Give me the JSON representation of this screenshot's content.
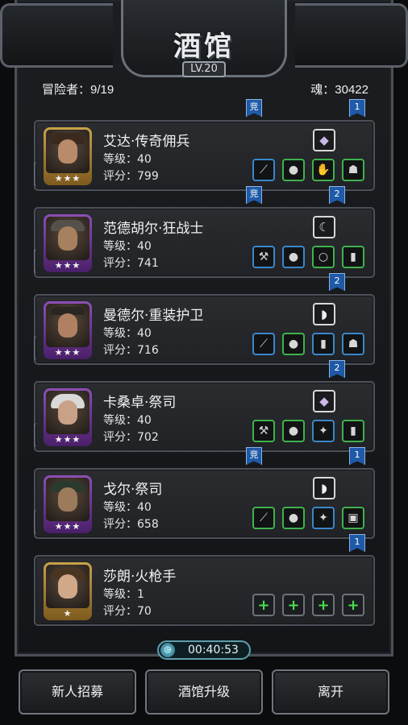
{
  "header": {
    "title": "酒馆",
    "level": "LV.20",
    "adventurers": "冒险者：9/19",
    "souls": "魂：30422"
  },
  "heroes": [
    {
      "name": "艾达·传奇佣兵",
      "level": "等级：40",
      "score": "评分：799",
      "stars": "★★★",
      "frame": "gold",
      "weapon_icon": "crystal-icon",
      "gear": [
        {
          "icon": "staff-icon",
          "color": "blue"
        },
        {
          "icon": "armor-icon",
          "color": "green"
        },
        {
          "icon": "gauntlet-icon",
          "color": "green"
        },
        {
          "icon": "pet-icon",
          "color": "green"
        }
      ]
    },
    {
      "name": "范德胡尔·狂战士",
      "level": "等级：40",
      "score": "评分：741",
      "stars": "★★★",
      "frame": "purple",
      "weapon_icon": "claw-icon",
      "gear": [
        {
          "icon": "axe-icon",
          "color": "blue"
        },
        {
          "icon": "armor-icon",
          "color": "blue"
        },
        {
          "icon": "ring-icon",
          "color": "green"
        },
        {
          "icon": "scroll-icon",
          "color": "green"
        }
      ]
    },
    {
      "name": "曼德尔·重装护卫",
      "level": "等级：40",
      "score": "评分：716",
      "stars": "★★★",
      "frame": "purple",
      "weapon_icon": "horn-icon",
      "gear": [
        {
          "icon": "sword-icon",
          "color": "blue"
        },
        {
          "icon": "armor-icon",
          "color": "green"
        },
        {
          "icon": "scroll-icon",
          "color": "blue"
        },
        {
          "icon": "pet-icon",
          "color": "blue"
        }
      ]
    },
    {
      "name": "卡桑卓·祭司",
      "level": "等级：40",
      "score": "评分：702",
      "stars": "★★★",
      "frame": "purple",
      "weapon_icon": "crystal-icon",
      "gear": [
        {
          "icon": "hammer-icon",
          "color": "green"
        },
        {
          "icon": "armor-icon",
          "color": "green"
        },
        {
          "icon": "amulet-icon",
          "color": "blue"
        },
        {
          "icon": "scroll-icon",
          "color": "green"
        }
      ]
    },
    {
      "name": "戈尔·祭司",
      "level": "等级：40",
      "score": "评分：658",
      "stars": "★★★",
      "frame": "purple",
      "weapon_icon": "horn-icon",
      "gear": [
        {
          "icon": "mace-icon",
          "color": "green"
        },
        {
          "icon": "armor-icon",
          "color": "green"
        },
        {
          "icon": "amulet-icon",
          "color": "blue"
        },
        {
          "icon": "barrel-icon",
          "color": "green"
        }
      ]
    },
    {
      "name": "莎朗·火枪手",
      "level": "等级：1",
      "score": "评分：70",
      "stars": "★",
      "frame": "gold",
      "weapon_icon": "",
      "gear": [
        {
          "icon": "add-icon",
          "color": "add"
        },
        {
          "icon": "add-icon",
          "color": "add"
        },
        {
          "icon": "add-icon",
          "color": "add"
        },
        {
          "icon": "add-icon",
          "color": "add"
        }
      ]
    }
  ],
  "tags": {
    "rank": "1",
    "rank2": "2",
    "compete": "竞"
  },
  "timer": "00:40:53",
  "buttons": {
    "recruit": "新人招募",
    "upgrade": "酒馆升级",
    "leave": "离开"
  }
}
